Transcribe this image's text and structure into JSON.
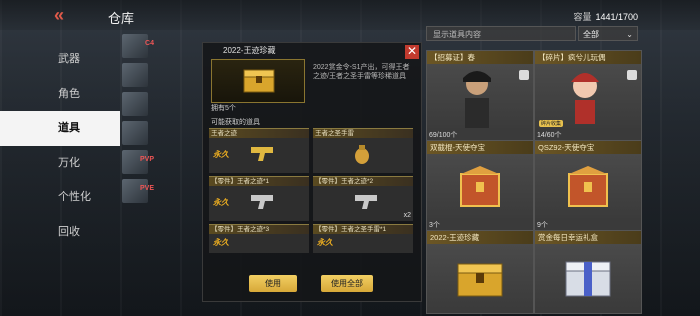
{
  "header": {
    "back_glyph": "«",
    "title": "仓库",
    "capacity_label": "容量",
    "capacity_value": "1441/1700"
  },
  "menu": [
    {
      "label": "武器",
      "active": false
    },
    {
      "label": "角色",
      "active": false
    },
    {
      "label": "道具",
      "active": true
    },
    {
      "label": "万化",
      "active": false
    },
    {
      "label": "个性化",
      "active": false
    },
    {
      "label": "回收",
      "active": false
    }
  ],
  "subicons": [
    {
      "icon": "ammo-crate-icon",
      "tag": "C4"
    },
    {
      "icon": "grenade-icon",
      "tag": ""
    },
    {
      "icon": "pvp-token-icon",
      "tag": ""
    },
    {
      "icon": "card-icon",
      "tag": ""
    },
    {
      "icon": "pvp-icon",
      "tag": "PVP"
    },
    {
      "icon": "pve-icon",
      "tag": "PVE"
    }
  ],
  "detail": {
    "title": "2022-王迹珍藏",
    "description": "2022赏金令-S1产出，可得王者之迹/王者之圣手雷等珍稀道具",
    "owned": "拥有5个",
    "available_label": "可能获取的道具",
    "items": [
      {
        "name": "王者之迹",
        "permanent": "永久",
        "qty": ""
      },
      {
        "name": "王者之圣手雷",
        "permanent": "",
        "qty": ""
      },
      {
        "name": "【零件】王者之迹*1",
        "permanent": "永久",
        "qty": ""
      },
      {
        "name": "【零件】王者之迹*2",
        "permanent": "",
        "qty": "x2"
      },
      {
        "name": "【零件】王者之迹*3",
        "permanent": "永久",
        "qty": ""
      },
      {
        "name": "【零件】王者之圣手雷*1",
        "permanent": "永久",
        "qty": ""
      }
    ],
    "use_label": "使用",
    "use_all_label": "使用全部"
  },
  "inventory": {
    "search_placeholder": "显示道具内容",
    "filter_value": "全部",
    "cards": [
      {
        "name": "【招募证】春",
        "count": "69/100个",
        "pill": ""
      },
      {
        "name": "【碎片】疯兮儿玩偶",
        "count": "14/60个",
        "pill": "碎片收集"
      },
      {
        "name": "双截棍-天使夺宝",
        "count": "3个",
        "pill": ""
      },
      {
        "name": "QSZ92-天使夺宝",
        "count": "9个",
        "pill": ""
      },
      {
        "name": "2022-王迹珍藏",
        "count": "",
        "pill": ""
      },
      {
        "name": "赏金每日幸运礼盒",
        "count": "",
        "pill": ""
      }
    ]
  },
  "colors": {
    "accent_gold": "#e7c14e",
    "close_red": "#c13a2e",
    "back_red": "#e05a4a"
  }
}
